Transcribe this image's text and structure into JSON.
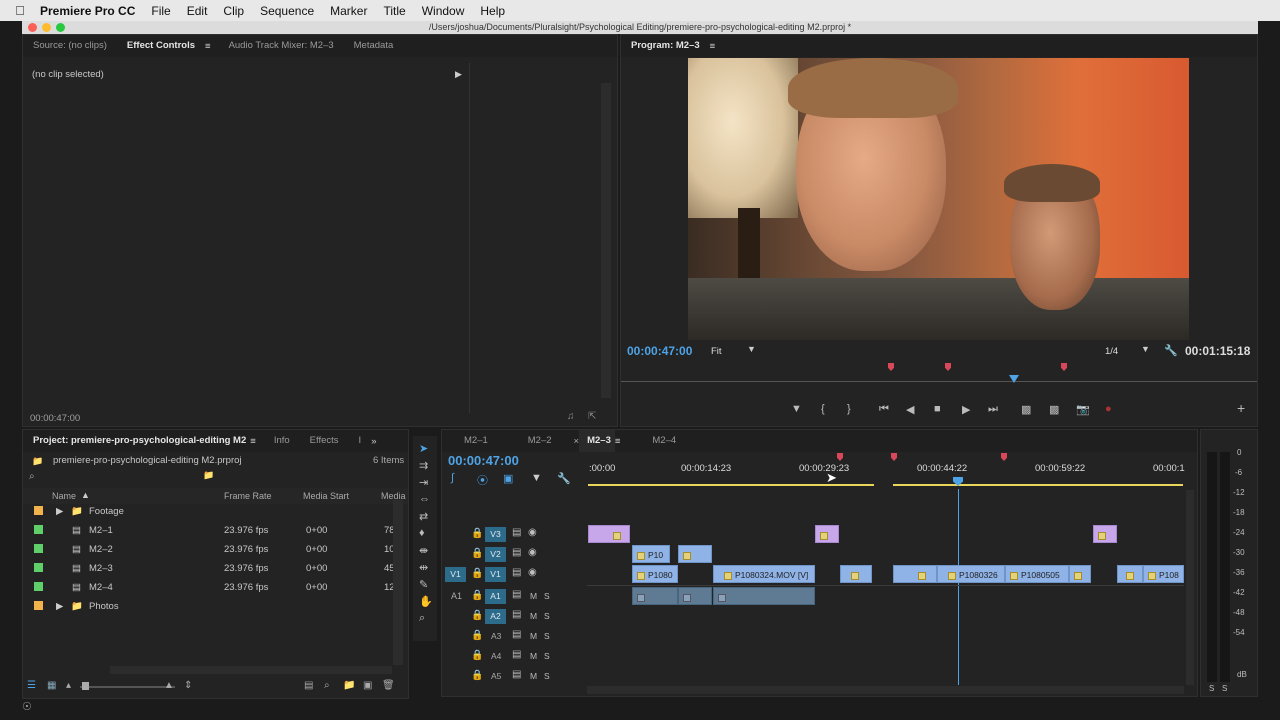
{
  "menubar": {
    "app_name": "Premiere Pro CC",
    "items": [
      "File",
      "Edit",
      "Clip",
      "Sequence",
      "Marker",
      "Title",
      "Window",
      "Help"
    ]
  },
  "window": {
    "title": "/Users/joshua/Documents/Pluralsight/Psychological Editing/premiere-pro-psychological-editing M2.prproj *"
  },
  "source_panel": {
    "tabs": [
      "Source: (no clips)",
      "Effect Controls",
      "Audio Track Mixer: M2–3",
      "Metadata"
    ],
    "active_tab": "Effect Controls",
    "no_clip_text": "(no clip selected)",
    "timecode": "00:00:47:00"
  },
  "program_panel": {
    "title": "Program: M2–3",
    "timecode_current": "00:00:47:00",
    "fit": "Fit",
    "resolution": "1/4",
    "timecode_duration": "00:01:15:18"
  },
  "project_panel": {
    "tabs": [
      "Project: premiere-pro-psychological-editing M2",
      "Info",
      "Effects",
      "I"
    ],
    "filename": "premiere-pro-psychological-editing M2.prproj",
    "item_count": "6 Items",
    "columns": [
      "Name",
      "Frame Rate",
      "Media Start",
      "Media"
    ],
    "rows": [
      {
        "name": "Footage",
        "type": "folder",
        "color": "#f2b24c",
        "frame_rate": "",
        "media_start": "",
        "media": ""
      },
      {
        "name": "M2–1",
        "type": "sequence",
        "color": "#5fcf6a",
        "frame_rate": "23.976 fps",
        "media_start": "0+00",
        "media": "78"
      },
      {
        "name": "M2–2",
        "type": "sequence",
        "color": "#5fcf6a",
        "frame_rate": "23.976 fps",
        "media_start": "0+00",
        "media": "10"
      },
      {
        "name": "M2–3",
        "type": "sequence",
        "color": "#5fcf6a",
        "frame_rate": "23.976 fps",
        "media_start": "0+00",
        "media": "45"
      },
      {
        "name": "M2–4",
        "type": "sequence",
        "color": "#5fcf6a",
        "frame_rate": "23.976 fps",
        "media_start": "0+00",
        "media": "12"
      },
      {
        "name": "Photos",
        "type": "folder",
        "color": "#f2b24c",
        "frame_rate": "",
        "media_start": "",
        "media": ""
      }
    ]
  },
  "timeline": {
    "tabs": [
      "M2–1",
      "M2–2",
      "M2–3",
      "M2–4"
    ],
    "active_tab": "M2–3",
    "timecode": "00:00:47:00",
    "ruler": [
      ":00:00",
      "00:00:14:23",
      "00:00:29:23",
      "00:00:44:22",
      "00:00:59:22",
      "00:00:1"
    ],
    "video_tracks": [
      "V3",
      "V2",
      "V1"
    ],
    "source_patch_video": "V1",
    "source_patch_audio": "A1",
    "audio_tracks": [
      "A1",
      "A2",
      "A3",
      "A4",
      "A5"
    ],
    "clip_labels": {
      "v2_a": "P10",
      "v1_a": "P1080",
      "v1_b": "P1080324.MOV [V]",
      "v1_c": "P1080326",
      "v1_d": "P1080505",
      "v1_e": "P108"
    },
    "m_label": "M",
    "s_label": "S"
  },
  "audio_meter": {
    "scale": [
      "0",
      "-6",
      "-12",
      "-18",
      "-24",
      "-30",
      "-36",
      "-42",
      "-48",
      "-54",
      "dB"
    ],
    "solo": [
      "S",
      "S"
    ]
  },
  "colors": {
    "accent_blue": "#4ea3e6",
    "clip_video": "#8fb3e6",
    "clip_purple": "#c7a7ea",
    "clip_audio": "#5f7b93",
    "marker_red": "#d9475a",
    "track_button": "#2d6b8a"
  }
}
